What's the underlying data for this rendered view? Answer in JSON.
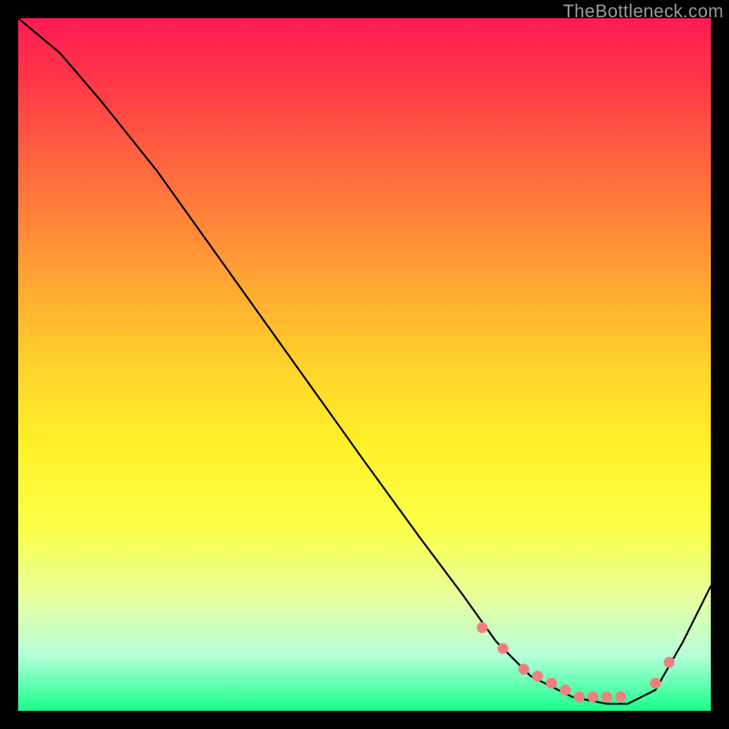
{
  "watermark": "TheBottleneck.com",
  "chart_data": {
    "type": "line",
    "title": "",
    "xlabel": "",
    "ylabel": "",
    "xlim": [
      0,
      100
    ],
    "ylim": [
      0,
      100
    ],
    "background_gradient": {
      "direction": "vertical",
      "stops": [
        {
          "pos": 0,
          "color": "#ff1a53"
        },
        {
          "pos": 10,
          "color": "#ff3b47"
        },
        {
          "pos": 22,
          "color": "#ff6a3e"
        },
        {
          "pos": 35,
          "color": "#ff9a35"
        },
        {
          "pos": 50,
          "color": "#ffd22b"
        },
        {
          "pos": 62,
          "color": "#fff229"
        },
        {
          "pos": 74,
          "color": "#fbff4a"
        },
        {
          "pos": 84,
          "color": "#e6ffa3"
        },
        {
          "pos": 92,
          "color": "#b5ffd8"
        },
        {
          "pos": 100,
          "color": "#18ff8d"
        }
      ]
    },
    "series": [
      {
        "name": "bottleneck-curve",
        "x": [
          0,
          6,
          12,
          20,
          30,
          40,
          50,
          58,
          64,
          69,
          74,
          80,
          85,
          88,
          92,
          96,
          100
        ],
        "y": [
          100,
          95,
          88,
          78,
          64,
          50,
          36,
          25,
          17,
          10,
          5,
          2,
          1,
          1,
          3,
          10,
          18
        ],
        "stroke": "#000000",
        "stroke_width": 2
      }
    ],
    "markers": [
      {
        "name": "optimal-range-dots",
        "shape": "circle",
        "color": "#f08080",
        "radius": 6,
        "points": [
          {
            "x": 67,
            "y": 12
          },
          {
            "x": 70,
            "y": 9
          },
          {
            "x": 73,
            "y": 6
          },
          {
            "x": 75,
            "y": 5
          },
          {
            "x": 77,
            "y": 4
          },
          {
            "x": 79,
            "y": 3
          },
          {
            "x": 81,
            "y": 2
          },
          {
            "x": 83,
            "y": 2
          },
          {
            "x": 85,
            "y": 2
          },
          {
            "x": 87,
            "y": 2
          },
          {
            "x": 92,
            "y": 4
          },
          {
            "x": 94,
            "y": 7
          }
        ]
      }
    ]
  }
}
